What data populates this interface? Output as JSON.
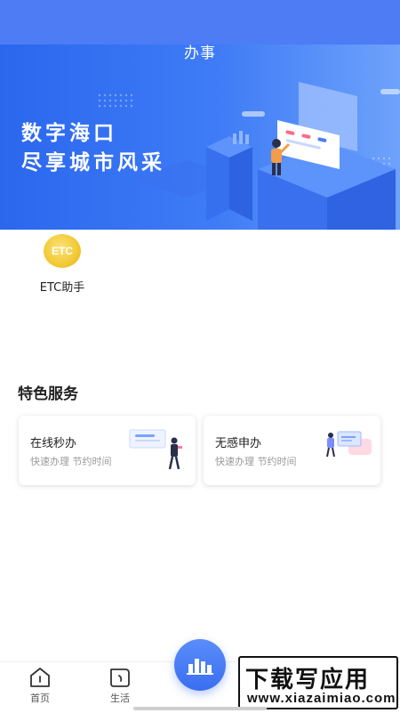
{
  "header": {
    "title": "办事"
  },
  "banner": {
    "line1": "数字海口",
    "line2": "尽享城市风采"
  },
  "quick_services": [
    {
      "label": "ETC助手",
      "icon_text": "ETC",
      "icon": "etc-coin-icon"
    }
  ],
  "featured": {
    "title": "特色服务",
    "cards": [
      {
        "title": "在线秒办",
        "subtitle": "快速办理 节约时间",
        "icon": "online-service-illustration"
      },
      {
        "title": "无感申办",
        "subtitle": "快速办理 节约时间",
        "icon": "seamless-apply-illustration"
      }
    ]
  },
  "bottom_nav": {
    "tabs": [
      {
        "label": "首页",
        "icon": "home-icon"
      },
      {
        "label": "生活",
        "icon": "life-icon"
      }
    ],
    "center_button_icon": "city-icon"
  },
  "watermark": {
    "main": "下载写应用",
    "sub": "www.xiazaimiao.com"
  },
  "colors": {
    "primary": "#3f7cf6",
    "accent": "#f2c935",
    "banner_start": "#2a67ee",
    "banner_end": "#6ea2fb"
  }
}
